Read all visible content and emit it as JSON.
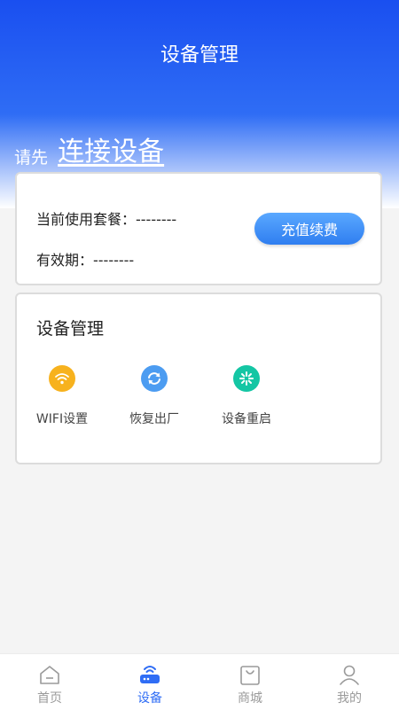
{
  "header": {
    "title": "设备管理",
    "connect_prefix": "请先",
    "connect_link": "连接设备"
  },
  "plan_card": {
    "plan_label": "当前使用套餐：--------",
    "expiry_label": "有效期：--------",
    "recharge_button": "充值续费"
  },
  "device_card": {
    "title": "设备管理",
    "functions": [
      {
        "label": "WIFI设置",
        "icon": "wifi-icon",
        "color": "#f7b21e"
      },
      {
        "label": "恢复出厂",
        "icon": "refresh-icon",
        "color": "#4c9cf1"
      },
      {
        "label": "设备重启",
        "icon": "reboot-icon",
        "color": "#14c6a4"
      }
    ]
  },
  "tabbar": {
    "tabs": [
      {
        "label": "首页",
        "icon": "home-icon",
        "active": false
      },
      {
        "label": "设备",
        "icon": "router-icon",
        "active": true
      },
      {
        "label": "商城",
        "icon": "shopping-bag-icon",
        "active": false
      },
      {
        "label": "我的",
        "icon": "profile-icon",
        "active": false
      }
    ]
  },
  "colors": {
    "accent": "#2f6df5",
    "header_top": "#1a4ff0",
    "inactive_tab": "#9a9a9a"
  }
}
